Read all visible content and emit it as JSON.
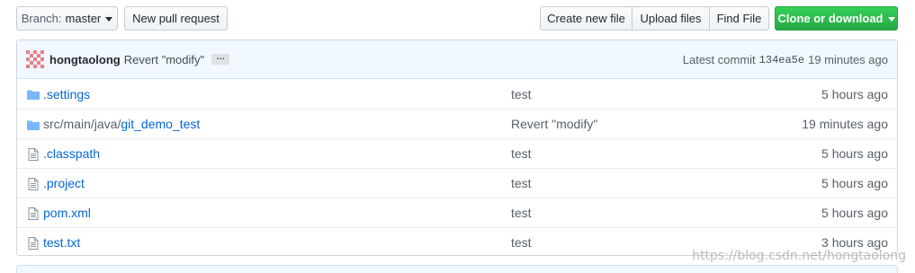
{
  "toolbar": {
    "branch_prefix": "Branch:",
    "branch_name": "master",
    "new_pull_request": "New pull request",
    "create_new_file": "Create new file",
    "upload_files": "Upload files",
    "find_file": "Find File",
    "clone_or_download": "Clone or download"
  },
  "commit": {
    "author": "hongtaolong",
    "message": "Revert \"modify\"",
    "ellipsis": "…",
    "latest_label": "Latest commit",
    "sha": "134ea5e",
    "age": "19 minutes ago"
  },
  "files": [
    {
      "type": "folder",
      "name": ".settings",
      "dir_prefix": "",
      "message": "test",
      "age": "5 hours ago"
    },
    {
      "type": "folder",
      "name": "git_demo_test",
      "dir_prefix": "src/main/java/",
      "message": "Revert \"modify\"",
      "age": "19 minutes ago"
    },
    {
      "type": "file",
      "name": ".classpath",
      "dir_prefix": "",
      "message": "test",
      "age": "5 hours ago"
    },
    {
      "type": "file",
      "name": ".project",
      "dir_prefix": "",
      "message": "test",
      "age": "5 hours ago"
    },
    {
      "type": "file",
      "name": "pom.xml",
      "dir_prefix": "",
      "message": "test",
      "age": "5 hours ago"
    },
    {
      "type": "file",
      "name": "test.txt",
      "dir_prefix": "",
      "message": "test",
      "age": "3 hours ago"
    }
  ],
  "watermark": "https://blog.csdn.net/hongtaolong",
  "colors": {
    "link": "#0366d6",
    "green_button": "#28a745",
    "commit_bar_bg": "#f1f8ff",
    "folder_icon": "#79b8ff"
  },
  "icons": {
    "folder": "folder-icon",
    "file": "file-icon",
    "avatar": "identicon-avatar"
  }
}
